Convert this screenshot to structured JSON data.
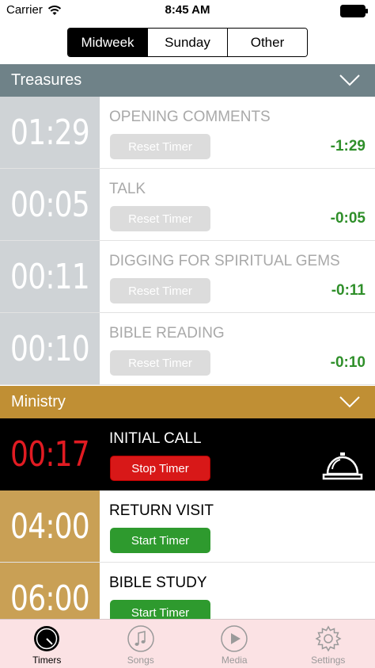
{
  "status_bar": {
    "carrier": "Carrier",
    "time": "8:45 AM"
  },
  "segments": [
    {
      "label": "Midweek",
      "active": true
    },
    {
      "label": "Sunday",
      "active": false
    },
    {
      "label": "Other",
      "active": false
    }
  ],
  "treasures": {
    "title": "Treasures",
    "color": "#6f8288",
    "rows": [
      {
        "time": "01:29",
        "title": "OPENING COMMENTS",
        "button": "Reset Timer",
        "delta": "-1:29"
      },
      {
        "time": "00:05",
        "title": "TALK",
        "button": "Reset Timer",
        "delta": "-0:05"
      },
      {
        "time": "00:11",
        "title": "DIGGING FOR SPIRITUAL GEMS",
        "button": "Reset Timer",
        "delta": "-0:11"
      },
      {
        "time": "00:10",
        "title": "BIBLE READING",
        "button": "Reset Timer",
        "delta": "-0:10"
      }
    ]
  },
  "ministry": {
    "title": "Ministry",
    "color": "#c08f34",
    "rows": [
      {
        "time": "00:17",
        "title": "INITIAL CALL",
        "button": "Stop Timer",
        "state": "running",
        "icon": "bell-icon"
      },
      {
        "time": "04:00",
        "title": "RETURN VISIT",
        "button": "Start Timer",
        "state": "idle"
      },
      {
        "time": "06:00",
        "title": "BIBLE STUDY",
        "button": "Start Timer",
        "state": "idle"
      }
    ]
  },
  "tabs": [
    {
      "label": "Timers",
      "icon": "stopwatch-icon",
      "active": true
    },
    {
      "label": "Songs",
      "icon": "music-note-icon",
      "active": false
    },
    {
      "label": "Media",
      "icon": "play-icon",
      "active": false
    },
    {
      "label": "Settings",
      "icon": "gear-icon",
      "active": false
    }
  ],
  "colors": {
    "delta_green": "#2f8f2a",
    "stop_red": "#d81818",
    "start_green": "#2e9a2e",
    "running_time_red": "#e11b22"
  }
}
